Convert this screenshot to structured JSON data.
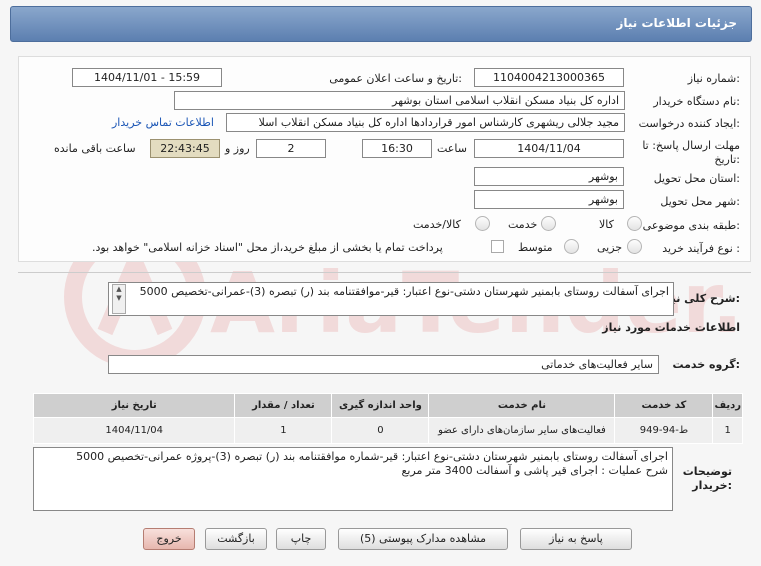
{
  "header": {
    "title": "جزئیات اطلاعات نیاز"
  },
  "fields": {
    "need_number_label": "شماره نیاز:",
    "need_number": "1104004213000365",
    "announce_label": "تاریخ و ساعت اعلان عمومی:",
    "announce_value": "1404/11/01 - 15:59",
    "buyer_label": "نام دستگاه خریدار:",
    "buyer_value": "اداره کل بنیاد مسکن انقلاب اسلامی استان بوشهر",
    "creator_label": "ایجاد کننده درخواست:",
    "creator_value": "مجید جلالی ریشهری کارشناس امور قراردادها اداره کل بنیاد مسکن انقلاب اسلا",
    "contact_link": "اطلاعات تماس خریدار",
    "deadline_label_1": "مهلت ارسال پاسخ: تا",
    "deadline_label_2": "تاریخ:",
    "deadline_date": "1404/11/04",
    "time_label": "ساعت",
    "deadline_time": "16:30",
    "days_value": "2",
    "days_label": "روز و",
    "remaining_time": "22:43:45",
    "remaining_label": "ساعت باقی مانده",
    "province_label": "استان محل تحویل:",
    "province_value": "بوشهر",
    "city_label": "شهر محل تحویل:",
    "city_value": "بوشهر",
    "category_label": "طبقه بندی موضوعی:",
    "category_options": [
      "کالا",
      "خدمت",
      "کالا/خدمت"
    ],
    "process_label": "نوع فرآیند خرید :",
    "process_options": [
      "جزیی",
      "متوسط"
    ],
    "payment_note": "پرداخت تمام یا بخشی از مبلغ خرید،از محل \"اسناد خزانه اسلامی\" خواهد بود."
  },
  "summary": {
    "label": "شرح کلی نیاز:",
    "text": "اجرای آسفالت روستای بابمنیر  شهرستان دشتی-نوع اعتبار: قیر-موافقتنامه بند (ر) تبصره (3)-عمرانی-تخصیص 5000"
  },
  "services": {
    "section_title": "اطلاعات خدمات مورد نیاز",
    "group_label": "گروه خدمت:",
    "group_value": "سایر فعالیت‌های خدماتی",
    "columns": [
      "ردیف",
      "کد خدمت",
      "نام خدمت",
      "واحد اندازه گیری",
      "تعداد / مقدار",
      "تاریخ نیاز"
    ],
    "rows": [
      {
        "row": "1",
        "code": "ط-94-949",
        "name": "فعالیت‌های سایر سازمان‌های دارای عضو",
        "unit": "0",
        "qty": "1",
        "date": "1404/11/04"
      }
    ]
  },
  "buyer_notes": {
    "label_1": "توضیحات",
    "label_2": "خریدار:",
    "line1": "اجرای آسفالت روستای بابمنیر  شهرستان دشتی-نوع اعتبار: قیر-شماره موافقتنامه بند (ر) تبصره (3)-پروژه عمرانی-تخصیص 5000",
    "line2": "شرح عملیات : اجرای قیر پاشی و آسفالت 3400 متر مربع"
  },
  "buttons": {
    "reply": "پاسخ به نیاز",
    "docs": "مشاهده مدارک پیوستی (5)",
    "print": "چاپ",
    "back": "بازگشت",
    "exit": "خروج"
  },
  "watermark": {
    "text": "AriaTender.net"
  }
}
